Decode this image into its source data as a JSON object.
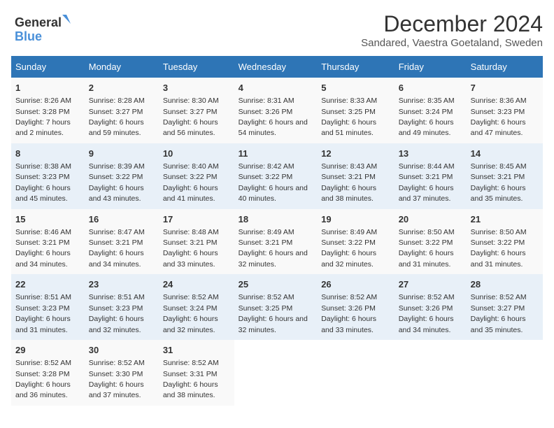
{
  "header": {
    "logo_line1": "General",
    "logo_line2": "Blue",
    "main_title": "December 2024",
    "subtitle": "Sandared, Vaestra Goetaland, Sweden"
  },
  "calendar": {
    "headers": [
      "Sunday",
      "Monday",
      "Tuesday",
      "Wednesday",
      "Thursday",
      "Friday",
      "Saturday"
    ],
    "weeks": [
      [
        {
          "day": "1",
          "sunrise": "8:26 AM",
          "sunset": "3:28 PM",
          "daylight": "7 hours and 2 minutes."
        },
        {
          "day": "2",
          "sunrise": "8:28 AM",
          "sunset": "3:27 PM",
          "daylight": "6 hours and 59 minutes."
        },
        {
          "day": "3",
          "sunrise": "8:30 AM",
          "sunset": "3:27 PM",
          "daylight": "6 hours and 56 minutes."
        },
        {
          "day": "4",
          "sunrise": "8:31 AM",
          "sunset": "3:26 PM",
          "daylight": "6 hours and 54 minutes."
        },
        {
          "day": "5",
          "sunrise": "8:33 AM",
          "sunset": "3:25 PM",
          "daylight": "6 hours and 51 minutes."
        },
        {
          "day": "6",
          "sunrise": "8:35 AM",
          "sunset": "3:24 PM",
          "daylight": "6 hours and 49 minutes."
        },
        {
          "day": "7",
          "sunrise": "8:36 AM",
          "sunset": "3:23 PM",
          "daylight": "6 hours and 47 minutes."
        }
      ],
      [
        {
          "day": "8",
          "sunrise": "8:38 AM",
          "sunset": "3:23 PM",
          "daylight": "6 hours and 45 minutes."
        },
        {
          "day": "9",
          "sunrise": "8:39 AM",
          "sunset": "3:22 PM",
          "daylight": "6 hours and 43 minutes."
        },
        {
          "day": "10",
          "sunrise": "8:40 AM",
          "sunset": "3:22 PM",
          "daylight": "6 hours and 41 minutes."
        },
        {
          "day": "11",
          "sunrise": "8:42 AM",
          "sunset": "3:22 PM",
          "daylight": "6 hours and 40 minutes."
        },
        {
          "day": "12",
          "sunrise": "8:43 AM",
          "sunset": "3:21 PM",
          "daylight": "6 hours and 38 minutes."
        },
        {
          "day": "13",
          "sunrise": "8:44 AM",
          "sunset": "3:21 PM",
          "daylight": "6 hours and 37 minutes."
        },
        {
          "day": "14",
          "sunrise": "8:45 AM",
          "sunset": "3:21 PM",
          "daylight": "6 hours and 35 minutes."
        }
      ],
      [
        {
          "day": "15",
          "sunrise": "8:46 AM",
          "sunset": "3:21 PM",
          "daylight": "6 hours and 34 minutes."
        },
        {
          "day": "16",
          "sunrise": "8:47 AM",
          "sunset": "3:21 PM",
          "daylight": "6 hours and 34 minutes."
        },
        {
          "day": "17",
          "sunrise": "8:48 AM",
          "sunset": "3:21 PM",
          "daylight": "6 hours and 33 minutes."
        },
        {
          "day": "18",
          "sunrise": "8:49 AM",
          "sunset": "3:21 PM",
          "daylight": "6 hours and 32 minutes."
        },
        {
          "day": "19",
          "sunrise": "8:49 AM",
          "sunset": "3:22 PM",
          "daylight": "6 hours and 32 minutes."
        },
        {
          "day": "20",
          "sunrise": "8:50 AM",
          "sunset": "3:22 PM",
          "daylight": "6 hours and 31 minutes."
        },
        {
          "day": "21",
          "sunrise": "8:50 AM",
          "sunset": "3:22 PM",
          "daylight": "6 hours and 31 minutes."
        }
      ],
      [
        {
          "day": "22",
          "sunrise": "8:51 AM",
          "sunset": "3:23 PM",
          "daylight": "6 hours and 31 minutes."
        },
        {
          "day": "23",
          "sunrise": "8:51 AM",
          "sunset": "3:23 PM",
          "daylight": "6 hours and 32 minutes."
        },
        {
          "day": "24",
          "sunrise": "8:52 AM",
          "sunset": "3:24 PM",
          "daylight": "6 hours and 32 minutes."
        },
        {
          "day": "25",
          "sunrise": "8:52 AM",
          "sunset": "3:25 PM",
          "daylight": "6 hours and 32 minutes."
        },
        {
          "day": "26",
          "sunrise": "8:52 AM",
          "sunset": "3:26 PM",
          "daylight": "6 hours and 33 minutes."
        },
        {
          "day": "27",
          "sunrise": "8:52 AM",
          "sunset": "3:26 PM",
          "daylight": "6 hours and 34 minutes."
        },
        {
          "day": "28",
          "sunrise": "8:52 AM",
          "sunset": "3:27 PM",
          "daylight": "6 hours and 35 minutes."
        }
      ],
      [
        {
          "day": "29",
          "sunrise": "8:52 AM",
          "sunset": "3:28 PM",
          "daylight": "6 hours and 36 minutes."
        },
        {
          "day": "30",
          "sunrise": "8:52 AM",
          "sunset": "3:30 PM",
          "daylight": "6 hours and 37 minutes."
        },
        {
          "day": "31",
          "sunrise": "8:52 AM",
          "sunset": "3:31 PM",
          "daylight": "6 hours and 38 minutes."
        },
        null,
        null,
        null,
        null
      ]
    ]
  }
}
